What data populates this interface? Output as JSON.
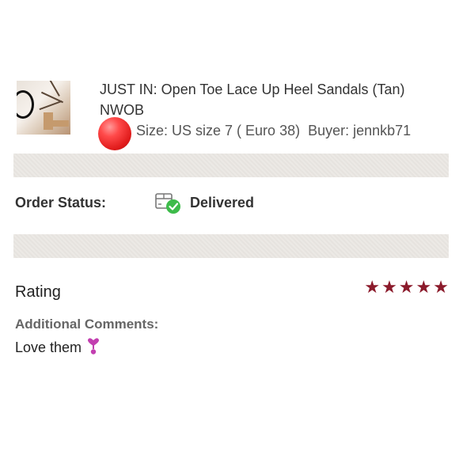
{
  "listing": {
    "title": "JUST IN: Open Toe Lace Up Heel Sandals (Tan) NWOB",
    "size": "Size: US size 7 ( Euro 38)",
    "buyer": "Buyer: jennkb71",
    "thumbnail_icon": "sandal-photo",
    "badge_icon": "red-ball"
  },
  "order": {
    "status_label": "Order Status:",
    "status_value": "Delivered",
    "status_icon": "delivered-box-check-icon",
    "status_color": "#3dbb4a"
  },
  "review": {
    "rating_label": "Rating",
    "rating_value": 5,
    "rating_max": 5,
    "star_color": "#8b1a2b",
    "comments_label": "Additional Comments:",
    "comment_text": "Love them",
    "comment_emoji": "heart-exclamation-icon"
  }
}
